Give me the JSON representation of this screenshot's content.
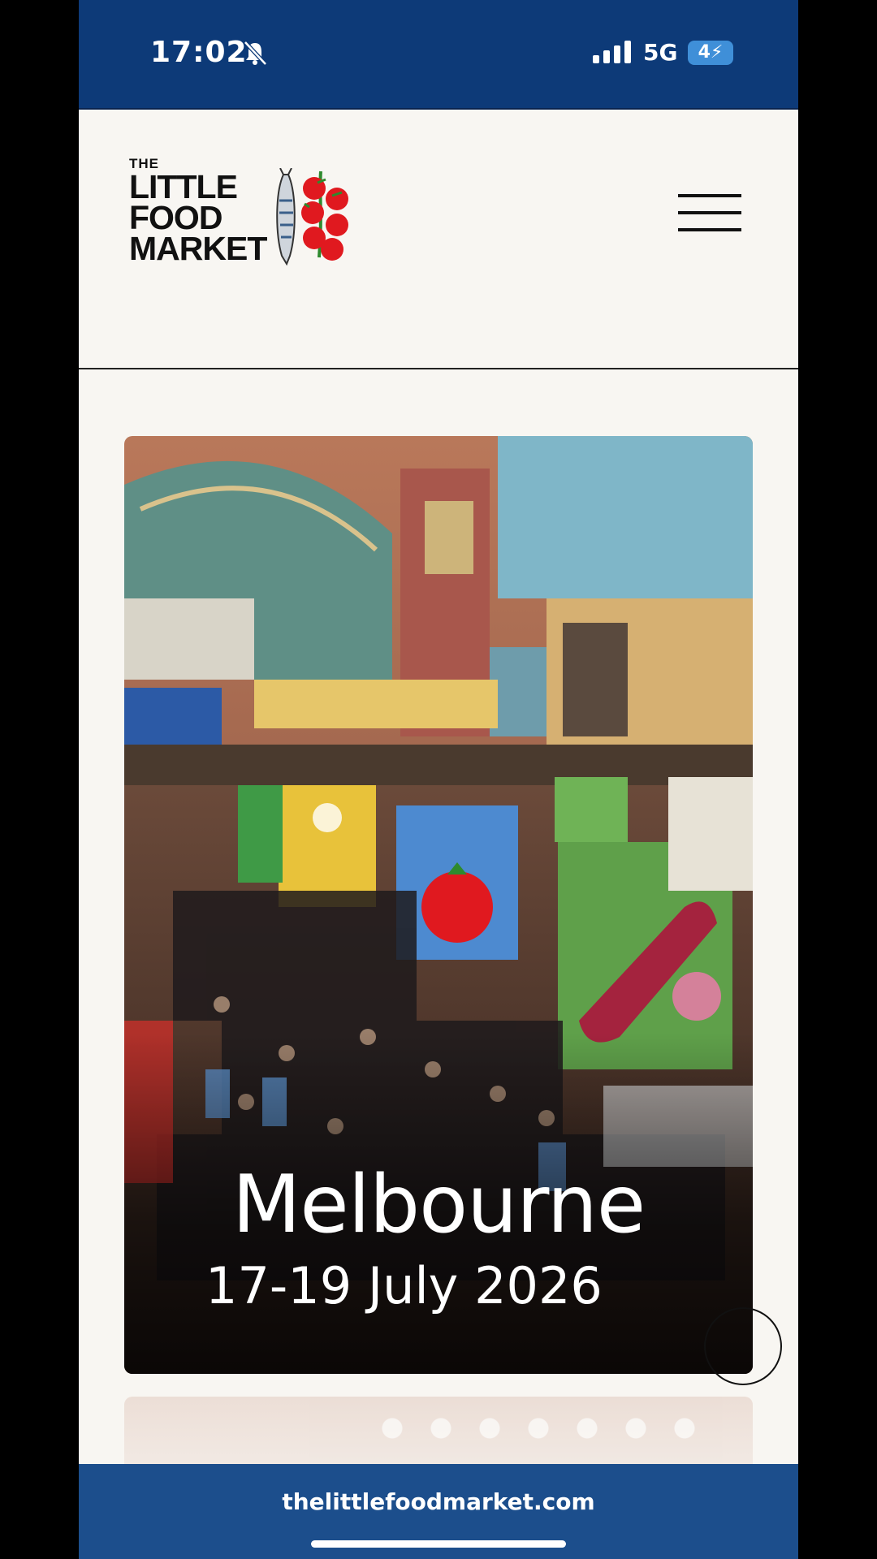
{
  "status_bar": {
    "time": "17:02",
    "network": "5G",
    "battery": "4"
  },
  "header": {
    "logo": {
      "line1": "THE",
      "line2": "LITTLE",
      "line3": "FOOD",
      "line4": "MARKET"
    },
    "menu_icon": "hamburger-menu-icon"
  },
  "hero": {
    "city": "Melbourne",
    "dates": "17-19 July 2026"
  },
  "browser": {
    "url": "thelittlefoodmarket.com"
  },
  "colors": {
    "status_bar": "#0d3a78",
    "url_bar": "#1c4e8c",
    "page_bg": "#f8f6f2",
    "tomato_red": "#e0191f"
  }
}
